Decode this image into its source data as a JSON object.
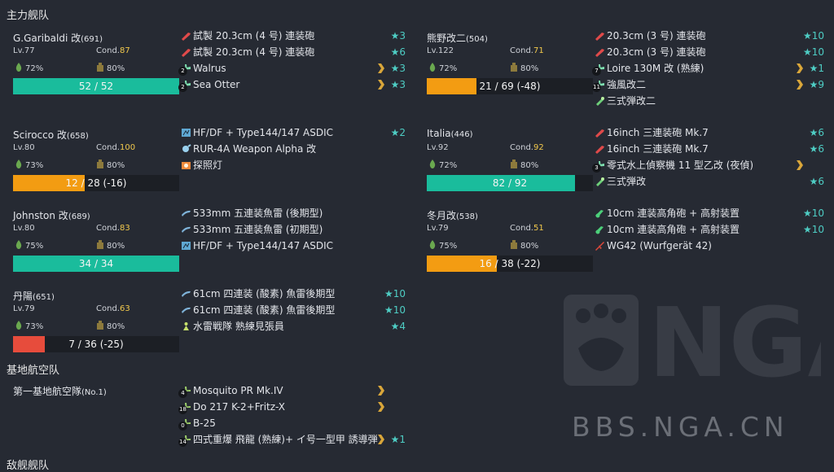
{
  "main_fleet_title": "主力舰队",
  "lbas_title": "基地航空队",
  "bottom_title": "敌舰舰队",
  "watermark_text": "BBS.NGA.CN",
  "colors": {
    "hp_green": "#1abc9c",
    "hp_orange": "#f39c12",
    "hp_red": "#e74c3c",
    "improvement": "#4ecdc4",
    "cond_yellow": "#f2c94c"
  },
  "ships": [
    {
      "name": "G.Garibaldi 改",
      "id": "(691)",
      "lv": "Lv.77",
      "cond_label": "Cond.",
      "cond": "87",
      "fuel": "72%",
      "ammo": "80%",
      "hp_text": "52 / 52",
      "hp_ratio": 1.0,
      "hp_state": "green"
    },
    {
      "name": "Scirocco 改",
      "id": "(658)",
      "lv": "Lv.80",
      "cond_label": "Cond.",
      "cond": "100",
      "fuel": "73%",
      "ammo": "80%",
      "hp_text": "12 / 28 (-16)",
      "hp_ratio": 0.43,
      "hp_state": "orange"
    },
    {
      "name": "Johnston 改",
      "id": "(689)",
      "lv": "Lv.80",
      "cond_label": "Cond.",
      "cond": "83",
      "fuel": "75%",
      "ammo": "80%",
      "hp_text": "34 / 34",
      "hp_ratio": 1.0,
      "hp_state": "green"
    },
    {
      "name": "丹陽",
      "id": "(651)",
      "lv": "Lv.79",
      "cond_label": "Cond.",
      "cond": "63",
      "fuel": "73%",
      "ammo": "80%",
      "hp_text": "7 / 36 (-25)",
      "hp_ratio": 0.19,
      "hp_state": "red"
    },
    {
      "name": "熊野改二",
      "id": "(504)",
      "lv": "Lv.122",
      "cond_label": "Cond.",
      "cond": "71",
      "fuel": "72%",
      "ammo": "80%",
      "hp_text": "21 / 69 (-48)",
      "hp_ratio": 0.3,
      "hp_state": "orange"
    },
    {
      "name": "Italia",
      "id": "(446)",
      "lv": "Lv.92",
      "cond_label": "Cond.",
      "cond": "92",
      "fuel": "72%",
      "ammo": "80%",
      "hp_text": "82 / 92",
      "hp_ratio": 0.89,
      "hp_state": "green"
    },
    {
      "name": "冬月改",
      "id": "(538)",
      "lv": "Lv.79",
      "cond_label": "Cond.",
      "cond": "51",
      "fuel": "75%",
      "ammo": "80%",
      "hp_text": "16 / 38 (-22)",
      "hp_ratio": 0.42,
      "hp_state": "orange"
    }
  ],
  "equipment": [
    [
      {
        "icon": "red-gun-icon",
        "name": "試製 20.3cm (4 号) 連装砲",
        "imp": "★3"
      },
      {
        "icon": "red-gun-icon",
        "name": "試製 20.3cm (4 号) 連装砲",
        "imp": "★6"
      },
      {
        "icon": "seaplane-icon",
        "slot": "2",
        "name": "Walrus",
        "prof": true,
        "imp": "★3"
      },
      {
        "icon": "seaplane-icon",
        "slot": "2",
        "name": "Sea Otter",
        "prof": true,
        "imp": "★3"
      }
    ],
    [
      {
        "icon": "sonar-icon",
        "name": "HF/DF + Type144/147 ASDIC",
        "imp": "★2"
      },
      {
        "icon": "depth-charge-icon",
        "name": "RUR-4A Weapon Alpha 改",
        "imp": ""
      },
      {
        "icon": "searchlight-icon",
        "name": "探照灯",
        "imp": ""
      }
    ],
    [
      {
        "icon": "torpedo-icon",
        "name": "533mm 五連装魚雷 (後期型)",
        "imp": ""
      },
      {
        "icon": "torpedo-icon",
        "name": "533mm 五連装魚雷 (初期型)",
        "imp": ""
      },
      {
        "icon": "sonar-icon",
        "name": "HF/DF + Type144/147 ASDIC",
        "imp": ""
      }
    ],
    [
      {
        "icon": "torpedo-icon",
        "name": "61cm 四連装 (酸素) 魚雷後期型",
        "imp": "★10"
      },
      {
        "icon": "torpedo-icon",
        "name": "61cm 四連装 (酸素) 魚雷後期型",
        "imp": "★10"
      },
      {
        "icon": "crew-icon",
        "name": "水雷戦隊 熟練見張員",
        "imp": "★4"
      }
    ],
    [
      {
        "icon": "red-gun-icon",
        "name": "20.3cm (3 号) 連装砲",
        "imp": "★10"
      },
      {
        "icon": "red-gun-icon",
        "name": "20.3cm (3 号) 連装砲",
        "imp": "★10"
      },
      {
        "icon": "seaplane-icon",
        "slot": "7",
        "name": "Loire 130M 改 (熟練)",
        "prof": true,
        "imp": "★1"
      },
      {
        "icon": "seaplane-icon",
        "slot": "11",
        "name": "強風改二",
        "prof": true,
        "imp": "★9"
      },
      {
        "icon": "shell-icon",
        "name": "三式弾改二",
        "imp": ""
      }
    ],
    [
      {
        "icon": "red-gun-icon",
        "name": "16inch 三連装砲 Mk.7",
        "imp": "★6"
      },
      {
        "icon": "red-gun-icon",
        "name": "16inch 三連装砲 Mk.7",
        "imp": "★6"
      },
      {
        "icon": "seaplane-icon",
        "slot": "3",
        "name": "零式水上偵察機 11 型乙改 (夜偵)",
        "prof": true,
        "imp": ""
      },
      {
        "icon": "shell-icon",
        "name": "三式弾改",
        "imp": "★6"
      }
    ],
    [
      {
        "icon": "green-gun-icon",
        "name": "10cm 連装高角砲 + 高射装置",
        "imp": "★10"
      },
      {
        "icon": "green-gun-icon",
        "name": "10cm 連装高角砲 + 高射装置",
        "imp": "★10"
      },
      {
        "icon": "rocket-icon",
        "name": "WG42 (Wurfgerät 42)",
        "imp": ""
      }
    ]
  ],
  "lbas": {
    "name": "第一基地航空隊",
    "id": "(No.1)",
    "planes": [
      {
        "icon": "lbas-plane-icon",
        "slot": "4",
        "name": "Mosquito PR Mk.IV",
        "prof": true,
        "imp": ""
      },
      {
        "icon": "lbas-plane-icon",
        "slot": "18",
        "name": "Do 217 K-2+Fritz-X",
        "prof": true,
        "imp": ""
      },
      {
        "icon": "lbas-plane-icon",
        "slot": "0",
        "name": "B-25",
        "prof": false,
        "imp": ""
      },
      {
        "icon": "lbas-plane-icon",
        "slot": "14",
        "name": "四式重爆 飛龍 (熟練)+ イ号一型甲 誘導弾",
        "prof": true,
        "imp": "★1"
      }
    ]
  }
}
